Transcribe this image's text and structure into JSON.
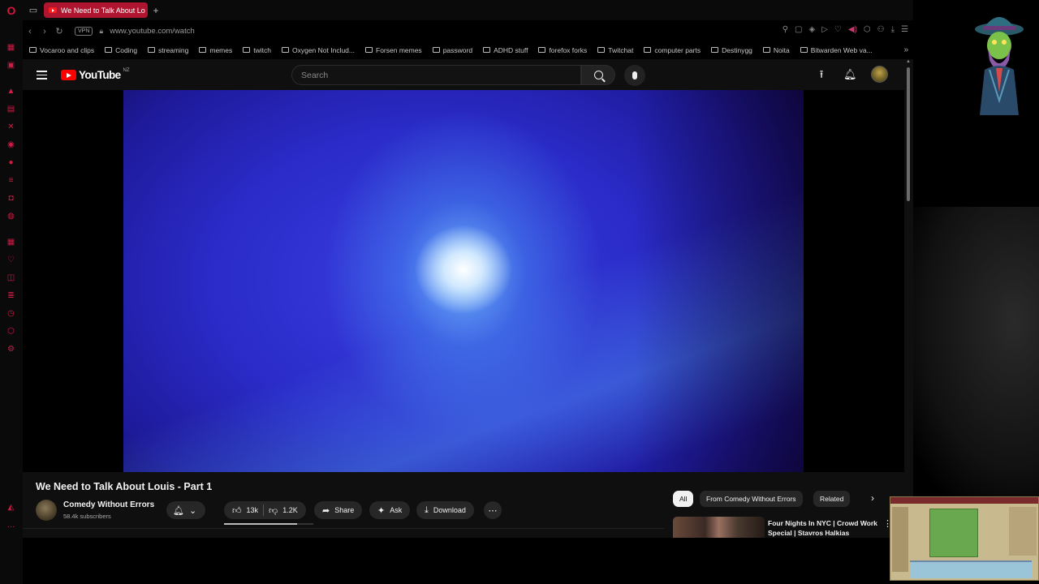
{
  "browser": {
    "tab_title": "We Need to Talk About Lo",
    "url": "www.youtube.com/watch",
    "vpn_label": "VPN",
    "bookmarks": [
      "Vocaroo and clips",
      "Coding",
      "streaming",
      "memes",
      "twitch",
      "Oxygen Not Includ...",
      "Forsen memes",
      "password",
      "ADHD stuff",
      "forefox forks",
      "Twitchat",
      "computer parts",
      "Destinygg",
      "Noita",
      "Bitwarden Web va..."
    ]
  },
  "youtube": {
    "logo_text": "YouTube",
    "region": "NZ",
    "search_placeholder": "Search",
    "video_title": "We Need to Talk About Louis - Part 1",
    "channel_name": "Comedy Without Errors",
    "subscribers": "58.4k subscribers",
    "likes": "13k",
    "dislikes": "1.2K",
    "share_label": "Share",
    "ask_label": "Ask",
    "download_label": "Download",
    "chips": [
      "All",
      "From Comedy Without Errors",
      "Related"
    ],
    "recommendation_title": "Four Nights In NYC | Crowd Work Special | Stavros Halkias"
  },
  "colors": {
    "accent": "#d9163d",
    "youtube_red": "#ff0000",
    "page_bg": "#0f0f0f"
  }
}
